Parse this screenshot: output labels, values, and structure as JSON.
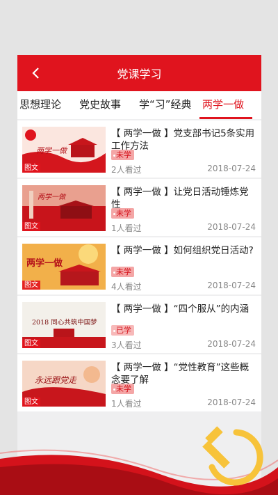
{
  "header": {
    "title": "党课学习",
    "back_icon": "chevron-left-icon"
  },
  "tabs": [
    {
      "label": "思想理论"
    },
    {
      "label": "党史故事"
    },
    {
      "label": "学“习”经典"
    },
    {
      "label": "两学一做",
      "active": true
    }
  ],
  "articles": [
    {
      "title": "【 两学一做 】党支部书记5条实用工作方法",
      "status": "未学",
      "views": "2人看过",
      "date": "2018-07-24",
      "type": "图文",
      "thumb_text": "两学一做"
    },
    {
      "title": "【 两学一做 】让党日活动锤炼党性",
      "status": "未学",
      "views": "1人看过",
      "date": "2018-07-24",
      "type": "图文",
      "thumb_text": "两学一做"
    },
    {
      "title": "【 两学一做 】如何组织党日活动?",
      "status": "未学",
      "views": "4人看过",
      "date": "2018-07-24",
      "type": "图文",
      "thumb_text": "两学一做"
    },
    {
      "title": "【 两学一做 】“四个服从”的内涵",
      "status": "已学",
      "views": "3人看过",
      "date": "2018-07-24",
      "type": "图文",
      "thumb_text": "2018 同心共筑中国梦"
    },
    {
      "title": "【 两学一做 】“党性教育”这些概念要了解",
      "status": "未学",
      "views": "1人看过",
      "date": "2018-07-24",
      "type": "图文",
      "thumb_text": "永远跟党走"
    }
  ],
  "colors": {
    "accent": "#e0141e",
    "background": "#e4e4e4"
  },
  "decoration": {
    "emblem_icon": "hammer-sickle-icon"
  }
}
